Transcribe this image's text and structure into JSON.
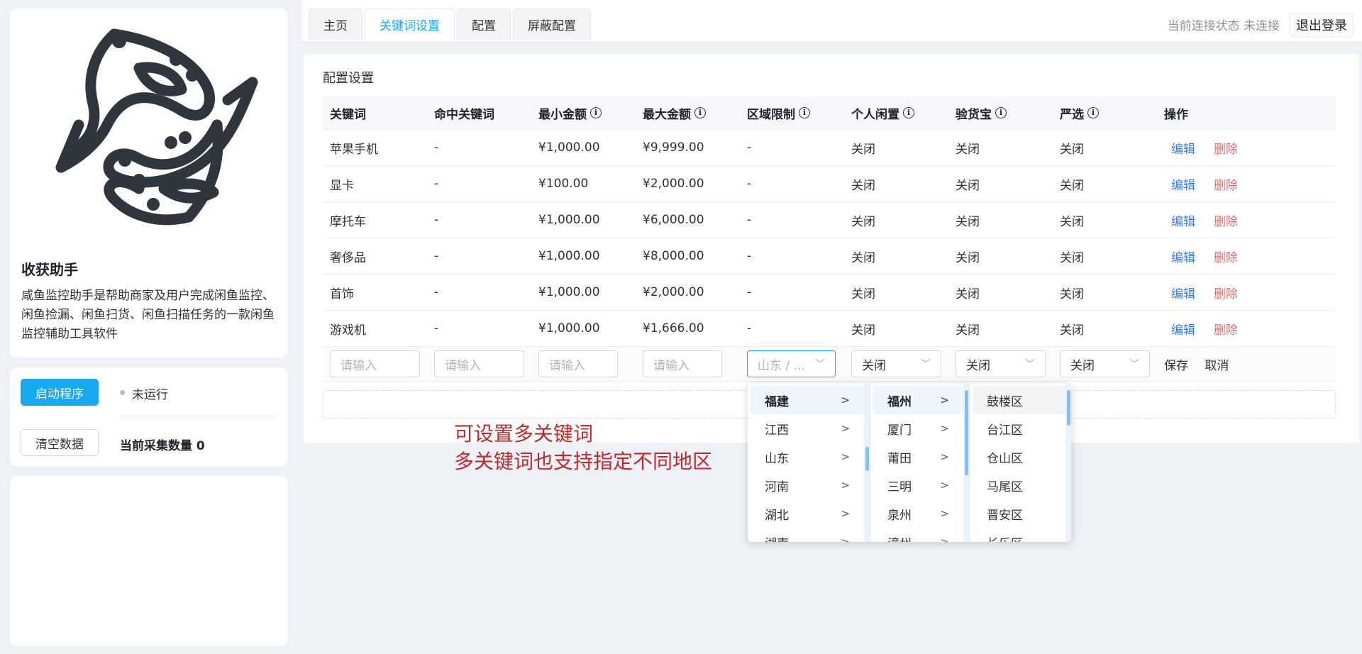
{
  "app": {
    "title": "收获助手",
    "description": "咸鱼监控助手是帮助商家及用户完成闲鱼监控、闲鱼捡漏、闲鱼扫货、闲鱼扫描任务的一款闲鱼监控辅助工具软件"
  },
  "control": {
    "start_label": "启动程序",
    "run_status": "未运行",
    "clear_label": "清空数据",
    "count_label": "当前采集数量 0"
  },
  "tabs": [
    {
      "label": "主页"
    },
    {
      "label": "关键词设置"
    },
    {
      "label": "配置"
    },
    {
      "label": "屏蔽配置"
    }
  ],
  "header": {
    "connection_status": "当前连接状态 未连接",
    "logout_label": "退出登录"
  },
  "config": {
    "section_title": "配置设置",
    "columns": [
      "关键词",
      "命中关键词",
      "最小金额",
      "最大金额",
      "区域限制",
      "个人闲置",
      "验货宝",
      "严选",
      "操作"
    ],
    "rows": [
      [
        "苹果手机",
        "-",
        "¥1,000.00",
        "¥9,999.00",
        "-",
        "关闭",
        "关闭",
        "关闭"
      ],
      [
        "显卡",
        "-",
        "¥100.00",
        "¥2,000.00",
        "-",
        "关闭",
        "关闭",
        "关闭"
      ],
      [
        "摩托车",
        "-",
        "¥1,000.00",
        "¥6,000.00",
        "-",
        "关闭",
        "关闭",
        "关闭"
      ],
      [
        "奢侈品",
        "-",
        "¥1,000.00",
        "¥8,000.00",
        "-",
        "关闭",
        "关闭",
        "关闭"
      ],
      [
        "首饰",
        "-",
        "¥1,000.00",
        "¥2,000.00",
        "-",
        "关闭",
        "关闭",
        "关闭"
      ],
      [
        "游戏机",
        "-",
        "¥1,000.00",
        "¥1,666.00",
        "-",
        "关闭",
        "关闭",
        "关闭"
      ]
    ],
    "edit_label": "编辑",
    "delete_label": "删除",
    "new_row": {
      "placeholder": "请输入",
      "region_value": "山东 / ...",
      "personal_value": "关闭",
      "inspect_value": "关闭",
      "strict_value": "关闭",
      "save_label": "保存",
      "cancel_label": "取消"
    }
  },
  "annotation": {
    "line1": "可设置多关键词",
    "line2": "多关键词也支持指定不同地区"
  },
  "cascader": {
    "provinces": [
      "福建",
      "江西",
      "山东",
      "河南",
      "湖北",
      "湖南"
    ],
    "cities": [
      "福州",
      "厦门",
      "莆田",
      "三明",
      "泉州",
      "漳州"
    ],
    "districts": [
      "鼓楼区",
      "台江区",
      "仓山区",
      "马尾区",
      "晋安区",
      "长乐区"
    ]
  },
  "colors": {
    "accent": "#18a9f0",
    "edit_link": "#3a7bd5",
    "delete_link": "#e46b6b",
    "annotation": "#c0282b"
  }
}
